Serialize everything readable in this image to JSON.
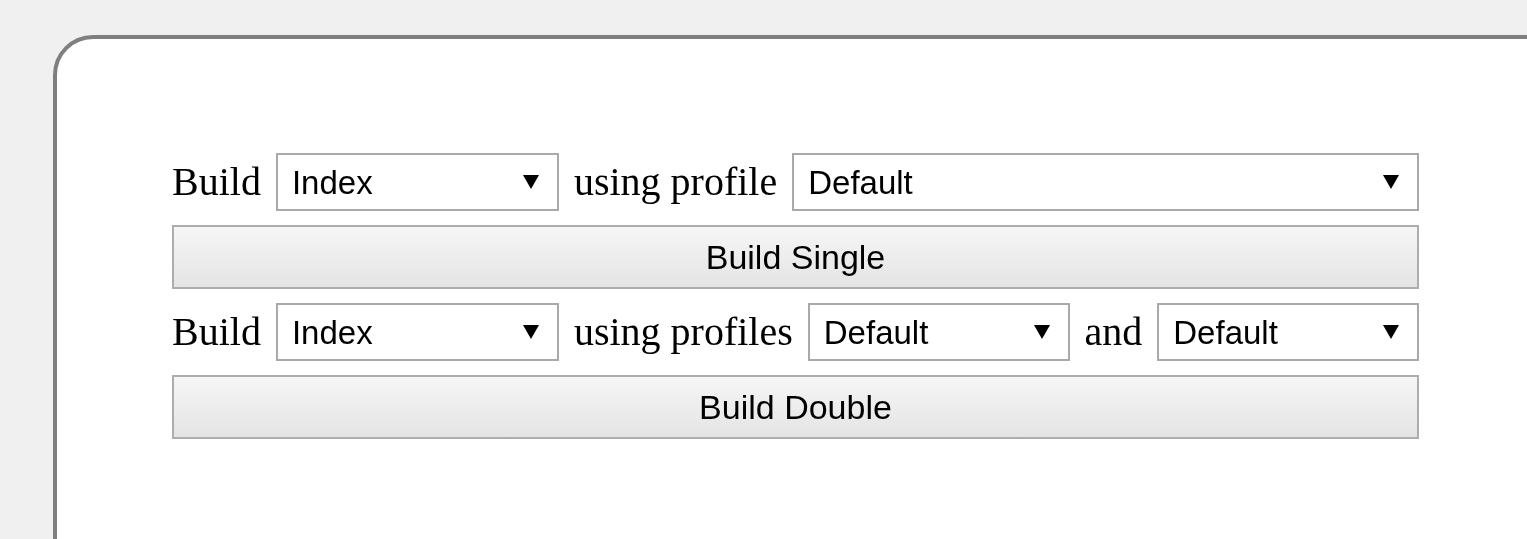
{
  "rows": [
    {
      "segments": [
        {
          "kind": "text",
          "text": "Build"
        },
        {
          "kind": "select",
          "value": "Index"
        },
        {
          "kind": "text",
          "text": "using profile"
        },
        {
          "kind": "select",
          "value": "Default"
        }
      ],
      "button": "Build Single"
    },
    {
      "segments": [
        {
          "kind": "text",
          "text": "Build"
        },
        {
          "kind": "select",
          "value": "Index"
        },
        {
          "kind": "text",
          "text": "using profiles"
        },
        {
          "kind": "select",
          "value": "Default"
        },
        {
          "kind": "text",
          "text": "and"
        },
        {
          "kind": "select",
          "value": "Default"
        }
      ],
      "button": "Build Double"
    }
  ]
}
